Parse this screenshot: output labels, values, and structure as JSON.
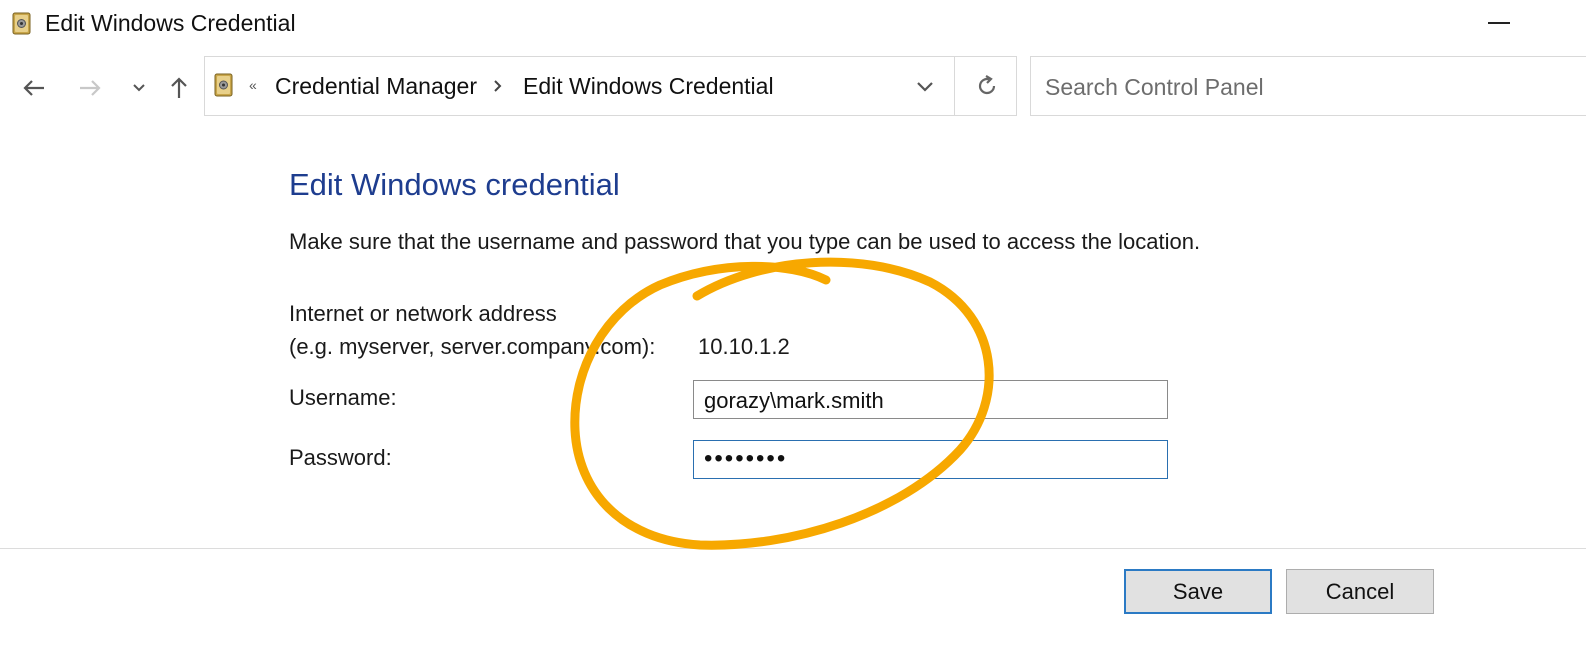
{
  "window": {
    "title": "Edit Windows Credential",
    "icon": "credential-vault-icon"
  },
  "nav": {
    "back_icon": "arrow-left-icon",
    "forward_icon": "arrow-right-icon",
    "recent_icon": "chevron-down-icon",
    "up_icon": "arrow-up-icon"
  },
  "address_bar": {
    "overflow_glyph": "«",
    "breadcrumbs": [
      "Credential Manager",
      "Edit Windows Credential"
    ],
    "refresh_icon": "refresh-icon"
  },
  "search": {
    "placeholder": "Search Control Panel"
  },
  "form": {
    "heading": "Edit Windows credential",
    "instructions": "Make sure that the username and password that you type can be used to access the location.",
    "address_label_line1": "Internet or network address",
    "address_label_line2": "(e.g. myserver, server.company.com):",
    "address_value": "10.10.1.2",
    "username_label": "Username:",
    "username_value": "gorazy\\mark.smith",
    "password_label": "Password:",
    "password_value": "••••••••"
  },
  "footer": {
    "save_label": "Save",
    "cancel_label": "Cancel"
  },
  "colors": {
    "heading": "#1e3d8f",
    "annotation": "#f7a800",
    "focus_border": "#2b7ac4"
  }
}
